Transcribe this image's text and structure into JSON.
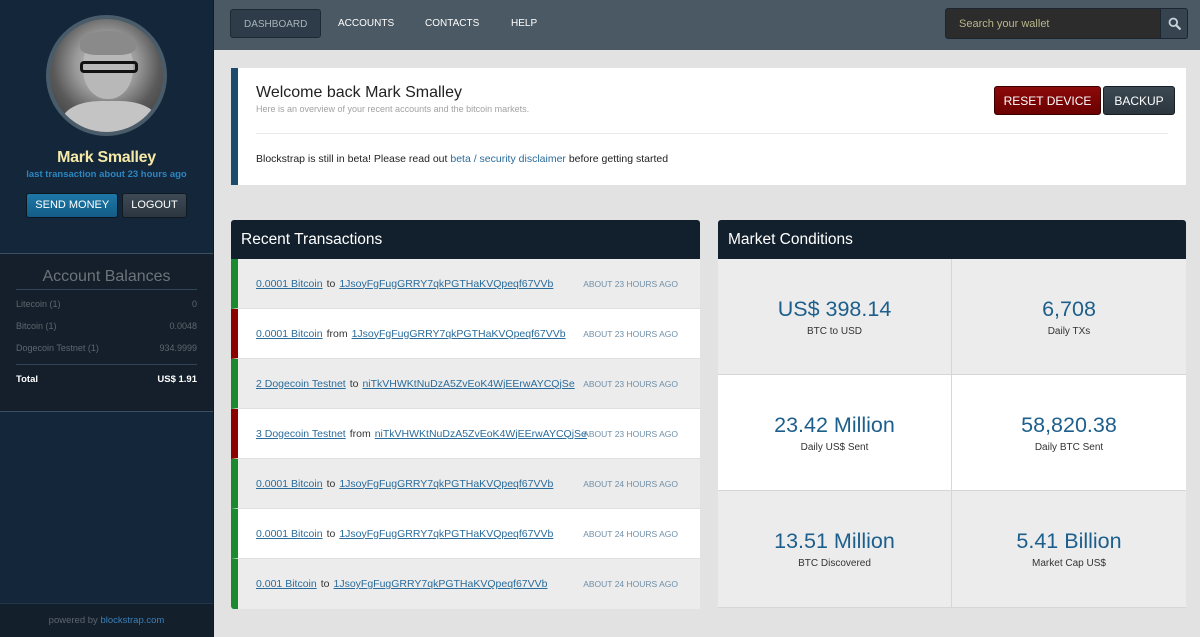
{
  "sidebar": {
    "user": {
      "name": "Mark Smalley",
      "last_transaction": "last transaction about 23 hours ago"
    },
    "buttons": {
      "send_money": "SEND MONEY",
      "logout": "LOGOUT"
    },
    "balances": {
      "title": "Account Balances",
      "items": [
        {
          "label": "Litecoin (1)",
          "value": "0"
        },
        {
          "label": "Bitcoin (1)",
          "value": "0.0048"
        },
        {
          "label": "Dogecoin Testnet (1)",
          "value": "934.9999"
        }
      ],
      "total_label": "Total",
      "total_value": "US$ 1.91"
    },
    "footer": {
      "prefix": "powered by",
      "link": "blockstrap.com"
    }
  },
  "nav": {
    "items": [
      {
        "label": "DASHBOARD",
        "active": true
      },
      {
        "label": "ACCOUNTS",
        "active": false
      },
      {
        "label": "CONTACTS",
        "active": false
      },
      {
        "label": "HELP",
        "active": false
      }
    ],
    "search": {
      "placeholder": "Search your wallet",
      "icon": "search-icon"
    }
  },
  "welcome": {
    "title": "Welcome back Mark Smalley",
    "subtitle": "Here is an overview of your recent accounts and the bitcoin markets.",
    "notice_before": "Blockstrap is still in beta! Please read out",
    "notice_link": "beta / security disclaimer",
    "notice_after": "before getting started",
    "reset_button": "RESET DEVICE",
    "backup_button": "BACKUP"
  },
  "transactions": {
    "title": "Recent Transactions",
    "colors": {
      "outgoing": "#1a8a2e",
      "incoming": "#8d0000"
    },
    "rows": [
      {
        "amount": "0.0001 Bitcoin",
        "direction": "to",
        "address": "1JsoyFgFugGRRY7qkPGTHaKVQpeqf67VVb",
        "time": "ABOUT 23 HOURS AGO",
        "type": "out"
      },
      {
        "amount": "0.0001 Bitcoin",
        "direction": "from",
        "address": "1JsoyFgFugGRRY7qkPGTHaKVQpeqf67VVb",
        "time": "ABOUT 23 HOURS AGO",
        "type": "in"
      },
      {
        "amount": "2 Dogecoin Testnet",
        "direction": "to",
        "address": "niTkVHWKtNuDzA5ZvEoK4WjEErwAYCQjSe",
        "time": "ABOUT 23 HOURS AGO",
        "type": "out"
      },
      {
        "amount": "3 Dogecoin Testnet",
        "direction": "from",
        "address": "niTkVHWKtNuDzA5ZvEoK4WjEErwAYCQjSe",
        "time": "ABOUT 23 HOURS AGO",
        "type": "in"
      },
      {
        "amount": "0.0001 Bitcoin",
        "direction": "to",
        "address": "1JsoyFgFugGRRY7qkPGTHaKVQpeqf67VVb",
        "time": "ABOUT 24 HOURS AGO",
        "type": "out"
      },
      {
        "amount": "0.0001 Bitcoin",
        "direction": "to",
        "address": "1JsoyFgFugGRRY7qkPGTHaKVQpeqf67VVb",
        "time": "ABOUT 24 HOURS AGO",
        "type": "out"
      },
      {
        "amount": "0.001 Bitcoin",
        "direction": "to",
        "address": "1JsoyFgFugGRRY7qkPGTHaKVQpeqf67VVb",
        "time": "ABOUT 24 HOURS AGO",
        "type": "out"
      }
    ]
  },
  "market": {
    "title": "Market Conditions",
    "stats": [
      {
        "value": "US$ 398.14",
        "label": "BTC to USD"
      },
      {
        "value": "6,708",
        "label": "Daily TXs"
      },
      {
        "value": "23.42 Million",
        "label": "Daily US$ Sent"
      },
      {
        "value": "58,820.38",
        "label": "Daily BTC Sent"
      },
      {
        "value": "13.51 Million",
        "label": "BTC Discovered"
      },
      {
        "value": "5.41 Billion",
        "label": "Market Cap US$"
      }
    ]
  }
}
